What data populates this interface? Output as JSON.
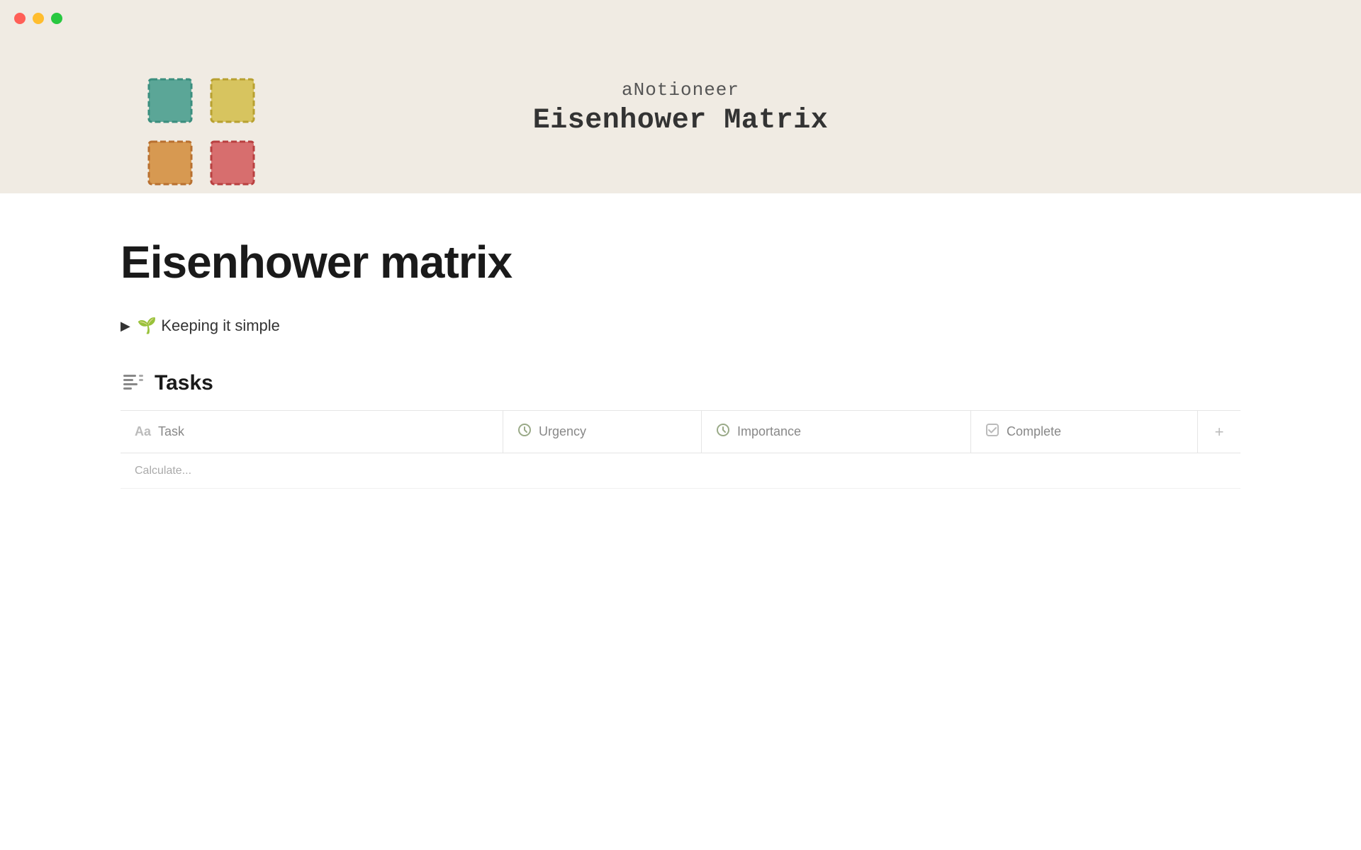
{
  "window": {
    "traffic_lights": [
      "red",
      "yellow",
      "green"
    ]
  },
  "hero": {
    "brand": "aNotioneer",
    "title": "Eisenhower Matrix",
    "background_color": "#f0ebe3"
  },
  "matrix_cells": [
    {
      "color": "#4a9e8e",
      "border": "#3a8e7e",
      "position": "top-left"
    },
    {
      "color": "#d4b84a",
      "border": "#c4a83a",
      "position": "top-right"
    },
    {
      "color": "#d4943a",
      "border": "#c4842a",
      "position": "bottom-left"
    },
    {
      "color": "#d4605a",
      "border": "#c4504a",
      "position": "bottom-right"
    }
  ],
  "page": {
    "title": "Eisenhower matrix"
  },
  "toggle": {
    "arrow": "▶",
    "emoji": "🌱",
    "text": "Keeping it simple"
  },
  "tasks": {
    "icon_label": "tasks-icon",
    "title": "Tasks"
  },
  "table": {
    "columns": [
      {
        "key": "task",
        "label": "Task",
        "icon": "Aa"
      },
      {
        "key": "urgency",
        "label": "Urgency",
        "icon": "●"
      },
      {
        "key": "importance",
        "label": "Importance",
        "icon": "●"
      },
      {
        "key": "complete",
        "label": "Complete",
        "icon": "☑"
      }
    ],
    "add_button_label": "+",
    "bottom_hint": "Calculate..."
  }
}
